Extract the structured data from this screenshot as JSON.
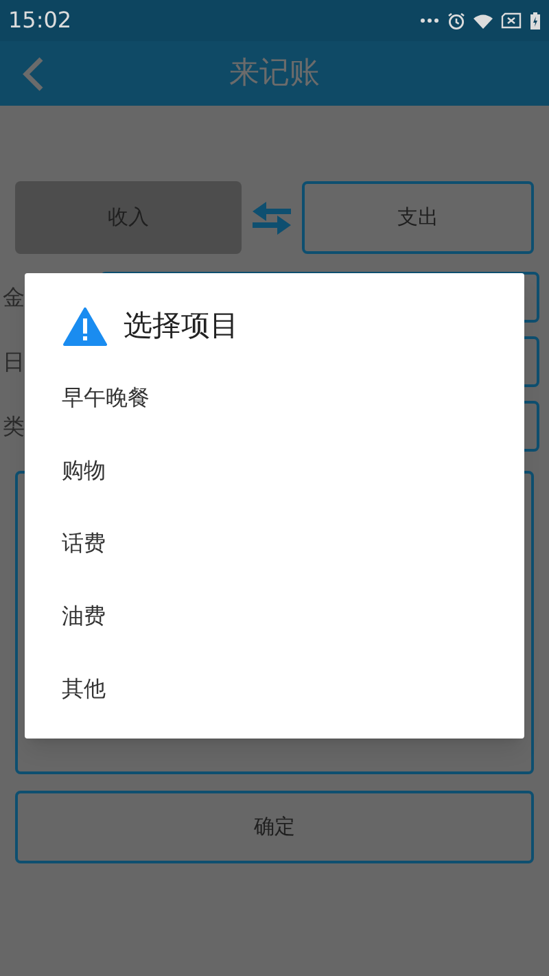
{
  "status_bar": {
    "time": "15:02"
  },
  "header": {
    "title": "来记账"
  },
  "type_toggle": [
    {
      "label": "收入",
      "selected": true
    },
    {
      "label": "支出",
      "selected": false
    }
  ],
  "form_labels": [
    "金",
    "日",
    "类"
  ],
  "confirm_button": "确定",
  "dialog": {
    "title": "选择项目",
    "items": [
      "早午晚餐",
      "购物",
      "话费",
      "油费",
      "其他"
    ]
  }
}
